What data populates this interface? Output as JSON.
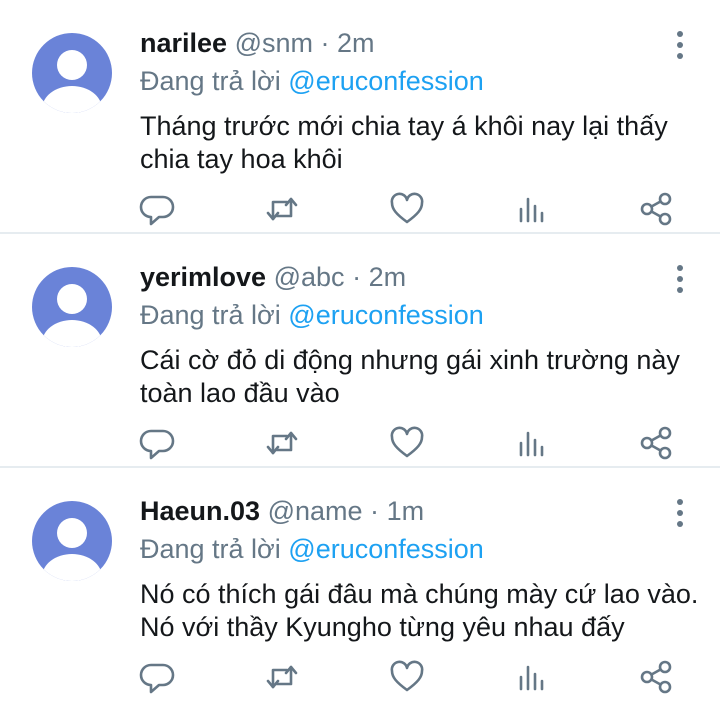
{
  "tweets": [
    {
      "name": "narilee",
      "handle": "@snm",
      "sep": "·",
      "time": "2m",
      "reply_prefix": "Đang trả lời",
      "reply_to": "@eruconfession",
      "text": "Tháng trước mới chia tay á khôi nay lại thấy chia tay hoa khôi"
    },
    {
      "name": "yerimlove",
      "handle": "@abc",
      "sep": "·",
      "time": "2m",
      "reply_prefix": "Đang trả lời",
      "reply_to": "@eruconfession",
      "text": "Cái cờ đỏ di động nhưng gái xinh trường này toàn lao đầu vào"
    },
    {
      "name": "Haeun.03",
      "handle": "@name",
      "sep": "·",
      "time": "1m",
      "reply_prefix": "Đang trả lời",
      "reply_to": "@eruconfession",
      "text": "Nó có thích gái đâu mà chúng mày cứ lao vào. Nó với thầy Kyungho từng yêu nhau đấy"
    }
  ],
  "icons": [
    "avatar",
    "more-vertical-icon",
    "reply-icon",
    "retweet-icon",
    "like-icon",
    "analytics-icon",
    "share-icon"
  ],
  "colors": {
    "accent": "#1da1f2",
    "muted": "#657786",
    "avatar": "#6a83d8",
    "divider": "#e6ecf0"
  }
}
